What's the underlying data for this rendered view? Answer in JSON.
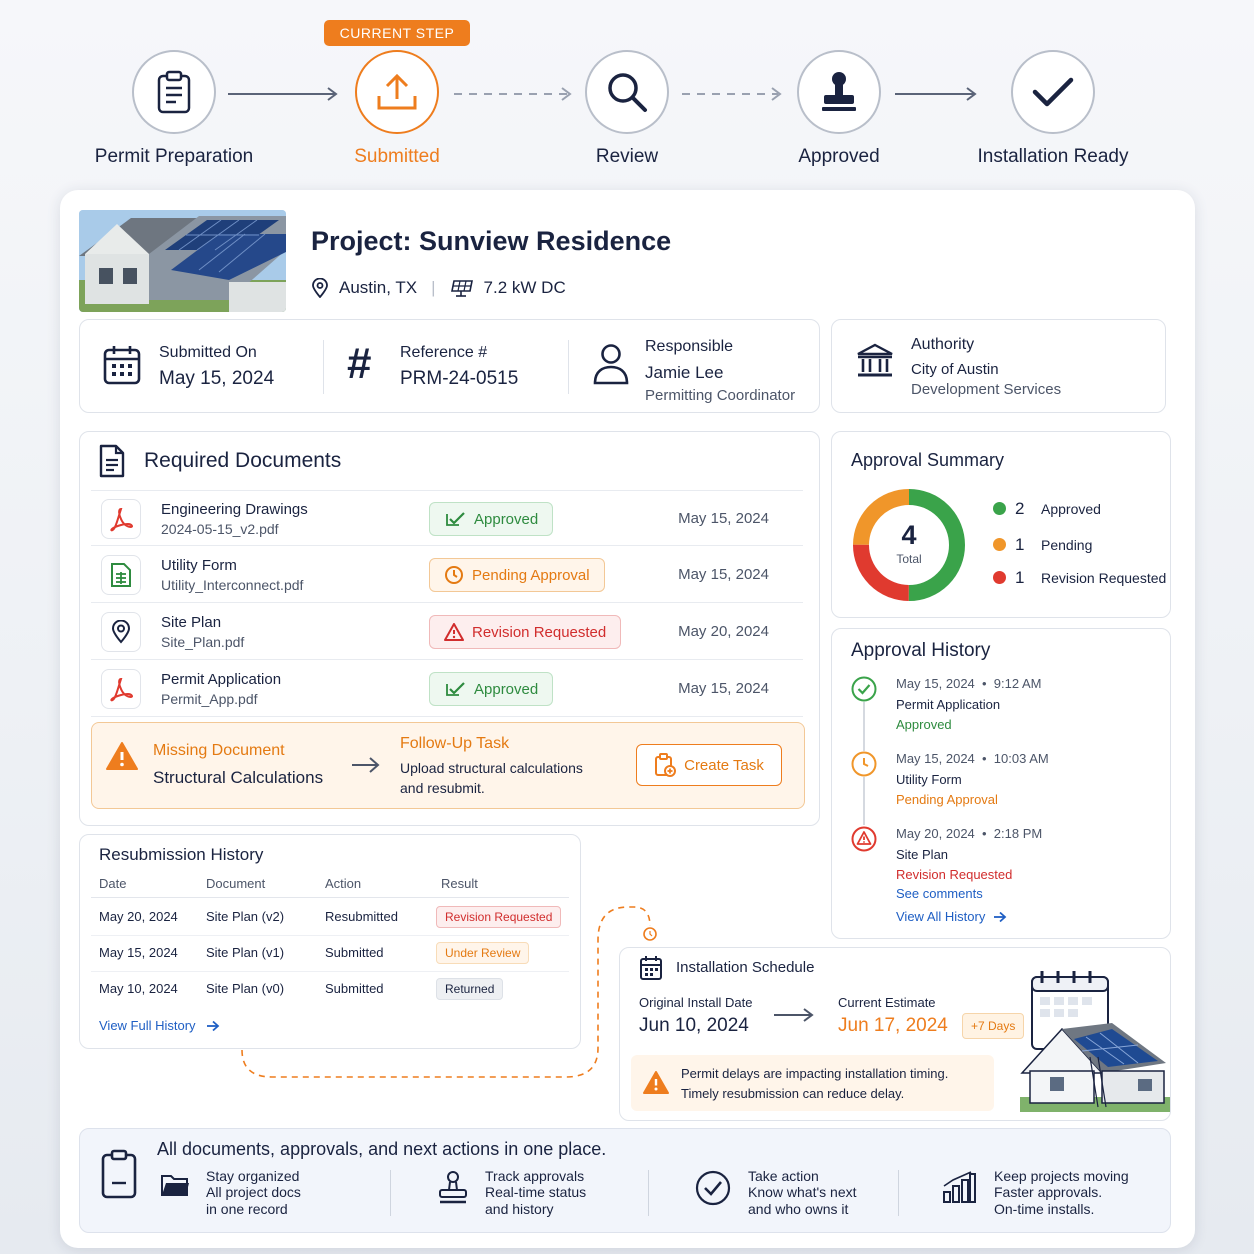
{
  "stepper": {
    "current_tag": "CURRENT STEP",
    "steps": [
      {
        "label": "Permit Preparation",
        "icon": "clipboard-icon"
      },
      {
        "label": "Submitted",
        "icon": "upload-icon"
      },
      {
        "label": "Review",
        "icon": "search-icon"
      },
      {
        "label": "Approved",
        "icon": "stamp-icon"
      },
      {
        "label": "Installation Ready",
        "icon": "checkmark-icon"
      }
    ],
    "current_index": 1
  },
  "project": {
    "title": "Project: Sunview Residence",
    "location": "Austin, TX",
    "system_size": "7.2 kW DC"
  },
  "info": {
    "submitted_label": "Submitted On",
    "submitted_value": "May 15, 2024",
    "reference_label": "Reference #",
    "reference_value": "PRM-24-0515",
    "responsible_label": "Responsible",
    "responsible_name": "Jamie Lee",
    "responsible_role": "Permitting Coordinator",
    "authority_label": "Authority",
    "authority_name": "City of Austin",
    "authority_dept": "Development Services"
  },
  "documents": {
    "title": "Required Documents",
    "rows": [
      {
        "name": "Engineering Drawings",
        "file": "2024-05-15_v2.pdf",
        "status": "Approved",
        "date": "May 15, 2024"
      },
      {
        "name": "Utility Form",
        "file": "Utility_Interconnect.pdf",
        "status": "Pending Approval",
        "date": "May 15, 2024"
      },
      {
        "name": "Site Plan",
        "file": "Site_Plan.pdf",
        "status": "Revision Requested",
        "date": "May 20, 2024"
      },
      {
        "name": "Permit Application",
        "file": "Permit_App.pdf",
        "status": "Approved",
        "date": "May 15, 2024"
      }
    ],
    "missing_label": "Missing Document",
    "missing_doc": "Structural Calculations",
    "followup_title": "Follow-Up Task",
    "followup_line1": "Upload structural calculations",
    "followup_line2": "and resubmit.",
    "create_task": "Create Task"
  },
  "summary": {
    "title": "Approval Summary",
    "total": "4",
    "total_label": "Total",
    "items": [
      {
        "count": "2",
        "label": "Approved",
        "color": "#3aa34a"
      },
      {
        "count": "1",
        "label": "Pending",
        "color": "#f0962a"
      },
      {
        "count": "1",
        "label": "Revision Requested",
        "color": "#e03a2f"
      }
    ]
  },
  "history": {
    "title": "Approval History",
    "entries": [
      {
        "date": "May 15, 2024",
        "time": "9:12 AM",
        "doc": "Permit Application",
        "status": "Approved"
      },
      {
        "date": "May 15, 2024",
        "time": "10:03 AM",
        "doc": "Utility Form",
        "status": "Pending Approval"
      },
      {
        "date": "May 20, 2024",
        "time": "2:18 PM",
        "doc": "Site Plan",
        "status": "Revision Requested"
      }
    ],
    "see_comments": "See comments",
    "view_all": "View All History"
  },
  "resubmission": {
    "title": "Resubmission History",
    "headers": [
      "Date",
      "Document",
      "Action",
      "Result"
    ],
    "rows": [
      {
        "date": "May 20, 2024",
        "doc": "Site Plan (v2)",
        "action": "Resubmitted",
        "result": "Revision Requested"
      },
      {
        "date": "May 15, 2024",
        "doc": "Site Plan (v1)",
        "action": "Submitted",
        "result": "Under Review"
      },
      {
        "date": "May 10, 2024",
        "doc": "Site Plan (v0)",
        "action": "Submitted",
        "result": "Returned"
      }
    ],
    "view_full": "View Full History"
  },
  "schedule": {
    "title": "Installation Schedule",
    "original_label": "Original Install Date",
    "original_value": "Jun 10, 2024",
    "estimate_label": "Current Estimate",
    "estimate_value": "Jun 17, 2024",
    "delay_badge": "+7 Days",
    "warning_line1": "Permit delays are impacting installation timing.",
    "warning_line2": "Timely resubmission can reduce delay."
  },
  "footer": {
    "headline": "All documents, approvals, and next actions in one place.",
    "items": [
      {
        "title": "Stay organized",
        "line1": "All project docs",
        "line2": "in one record"
      },
      {
        "title": "Track approvals",
        "line1": "Real-time status",
        "line2": "and history"
      },
      {
        "title": "Take action",
        "line1": "Know what's next",
        "line2": "and who owns it"
      },
      {
        "title": "Keep projects moving",
        "line1": "Faster approvals.",
        "line2": "On-time installs."
      }
    ]
  },
  "colors": {
    "accent": "#ee7d1e",
    "navy": "#1a2340",
    "approved": "#2e8b3f",
    "pending": "#e47a12",
    "revision": "#d12d2d",
    "link": "#1f5fc4"
  }
}
